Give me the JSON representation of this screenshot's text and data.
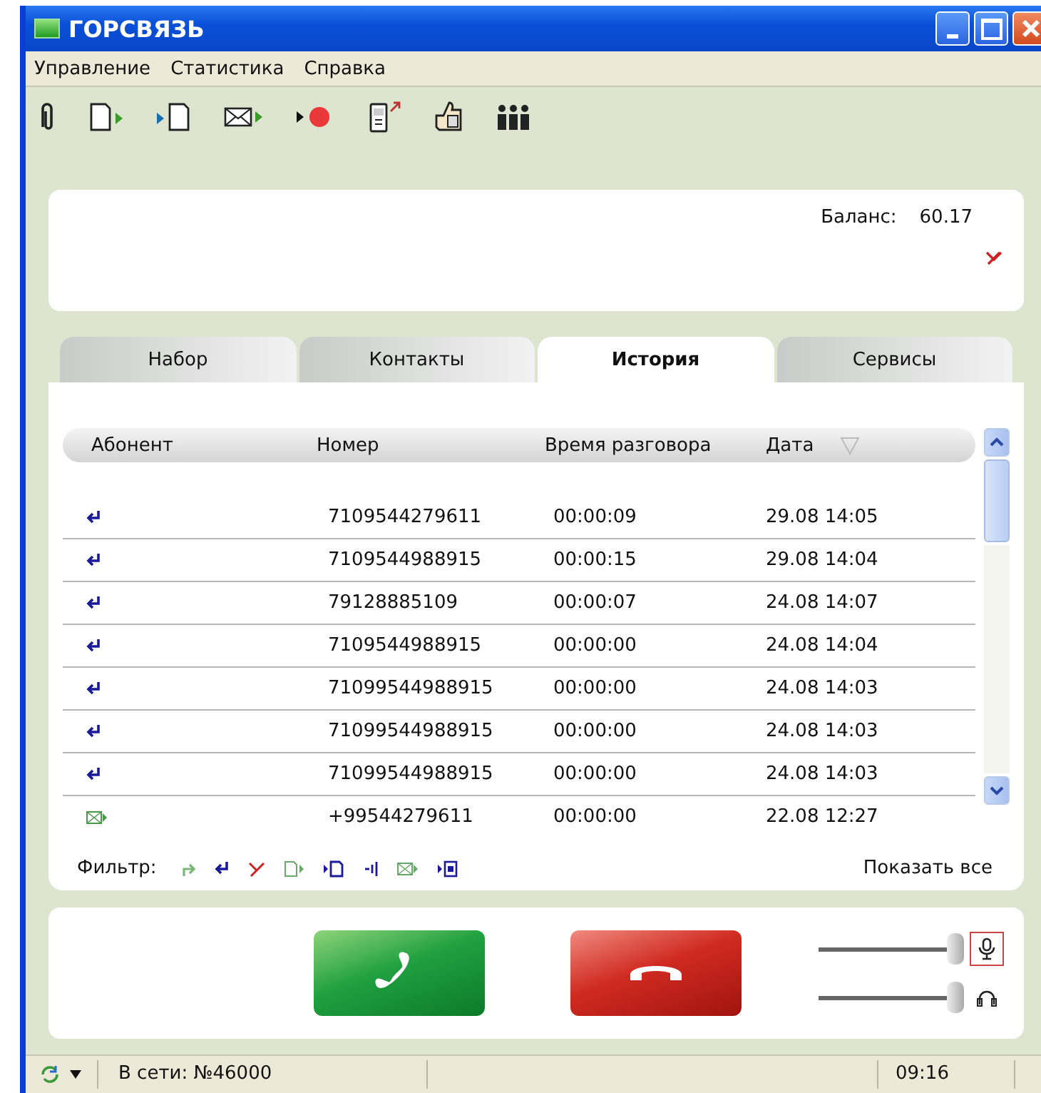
{
  "window": {
    "title": "ГОРСВЯЗЬ"
  },
  "menu": [
    "Управление",
    "Статистика",
    "Справка"
  ],
  "balance": {
    "label": "Баланс:",
    "value": "60.17"
  },
  "tabs": [
    {
      "label": "Набор",
      "selected": false
    },
    {
      "label": "Контакты",
      "selected": false
    },
    {
      "label": "История",
      "selected": true
    },
    {
      "label": "Сервисы",
      "selected": false
    }
  ],
  "table": {
    "columns": [
      "Абонент",
      "Номер",
      "Время разговора",
      "Дата"
    ],
    "rows": [
      {
        "kind": "incoming",
        "number": "7109544279611",
        "duration": "00:00:09",
        "date": "29.08 14:05"
      },
      {
        "kind": "incoming",
        "number": "7109544988915",
        "duration": "00:00:15",
        "date": "29.08 14:04"
      },
      {
        "kind": "incoming",
        "number": "79128885109",
        "duration": "00:00:07",
        "date": "24.08 14:07"
      },
      {
        "kind": "incoming",
        "number": "7109544988915",
        "duration": "00:00:00",
        "date": "24.08 14:04"
      },
      {
        "kind": "incoming",
        "number": "71099544988915",
        "duration": "00:00:00",
        "date": "24.08 14:03"
      },
      {
        "kind": "incoming",
        "number": "71099544988915",
        "duration": "00:00:00",
        "date": "24.08 14:03"
      },
      {
        "kind": "incoming",
        "number": "71099544988915",
        "duration": "00:00:00",
        "date": "24.08 14:03"
      },
      {
        "kind": "sms",
        "number": "+99544279611",
        "duration": "00:00:00",
        "date": "22.08 12:27"
      }
    ]
  },
  "filter": {
    "label": "Фильтр:",
    "show_all": "Показать все"
  },
  "volume": [
    {
      "kind": "microphone",
      "level": 1
    },
    {
      "kind": "headphones",
      "level": 1
    }
  ],
  "status_bar": {
    "network": "В сети: №46000",
    "time": "09:16"
  }
}
